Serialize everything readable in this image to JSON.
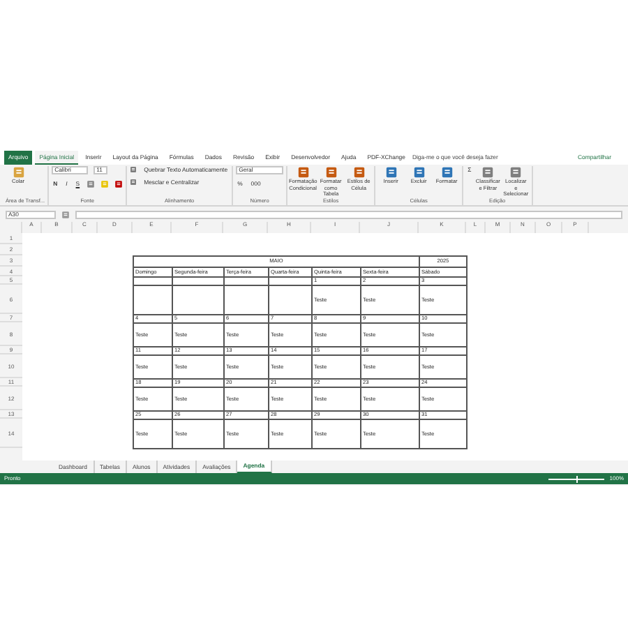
{
  "ribbon_tabs": [
    {
      "label": "Arquivo",
      "kind": "file"
    },
    {
      "label": "Página Inicial",
      "kind": "tab",
      "selected": true
    },
    {
      "label": "Inserir",
      "kind": "tab",
      "selected": false
    },
    {
      "label": "Layout da Página",
      "kind": "tab",
      "selected": false
    },
    {
      "label": "Fórmulas",
      "kind": "tab",
      "selected": false
    },
    {
      "label": "Dados",
      "kind": "tab",
      "selected": false
    },
    {
      "label": "Revisão",
      "kind": "tab",
      "selected": false
    },
    {
      "label": "Exibir",
      "kind": "tab",
      "selected": false
    },
    {
      "label": "Desenvolvedor",
      "kind": "tab",
      "selected": false
    },
    {
      "label": "Ajuda",
      "kind": "tab",
      "selected": false
    },
    {
      "label": "PDF-XChange",
      "kind": "tab",
      "selected": false
    }
  ],
  "tell_me": {
    "placeholder": "Diga-me o que você deseja fazer"
  },
  "share_button": "Compartilhar",
  "ribbon_groups": [
    {
      "name": "Área de Transf...",
      "controls": [
        {
          "kind": "big",
          "label": "Colar"
        }
      ]
    },
    {
      "name": "Fonte",
      "controls": [
        {
          "kind": "font",
          "font": "Calibri",
          "size": "11",
          "buttons": [
            "N",
            "I",
            "S"
          ]
        }
      ]
    },
    {
      "name": "Alinhamento",
      "controls": [
        {
          "kind": "wrap",
          "labels": [
            "Quebrar Texto Automaticamente",
            "Mesclar e Centralizar"
          ]
        }
      ]
    },
    {
      "name": "Número",
      "controls": [
        {
          "kind": "number",
          "format": "Geral",
          "buttons": [
            "%",
            "000"
          ]
        }
      ]
    },
    {
      "name": "Estilos",
      "controls": [
        {
          "kind": "big",
          "label": "Formatação Condicional"
        },
        {
          "kind": "big",
          "label": "Formatar como Tabela"
        },
        {
          "kind": "big",
          "label": "Estilos de Célula"
        }
      ]
    },
    {
      "name": "Células",
      "controls": [
        {
          "kind": "big",
          "label": "Inserir"
        },
        {
          "kind": "big",
          "label": "Excluir"
        },
        {
          "kind": "big",
          "label": "Formatar"
        }
      ]
    },
    {
      "name": "Edição",
      "controls": [
        {
          "kind": "sum",
          "label": "Σ"
        },
        {
          "kind": "big",
          "label": "Classificar e Filtrar"
        },
        {
          "kind": "big",
          "label": "Localizar e Selecionar"
        }
      ]
    }
  ],
  "name_box": "A30",
  "columns": [
    "A",
    "B",
    "C",
    "D",
    "E",
    "F",
    "G",
    "H",
    "I",
    "J",
    "K",
    "L",
    "M",
    "N",
    "O",
    "P"
  ],
  "row_numbers": [
    "1",
    "2",
    "3",
    "4",
    "5",
    "6",
    "7",
    "8",
    "9",
    "10",
    "11",
    "12",
    "13",
    "14"
  ],
  "calendar": {
    "month": "MAIO",
    "year": "2025",
    "weekdays": [
      "Domingo",
      "Segunda-feira",
      "Terça-feira",
      "Quarta-feira",
      "Quinta-feira",
      "Sexta-feira",
      "Sábado"
    ],
    "weeks": [
      [
        {
          "kind": "blank"
        },
        {
          "kind": "blank"
        },
        {
          "kind": "blank"
        },
        {
          "kind": "blank"
        },
        {
          "kind": "day",
          "day": "1",
          "note": "Teste"
        },
        {
          "kind": "day",
          "day": "2",
          "note": "Teste"
        },
        {
          "kind": "day",
          "day": "3",
          "note": "Teste"
        }
      ],
      [
        {
          "kind": "day",
          "day": "4",
          "note": "Teste"
        },
        {
          "kind": "day",
          "day": "5",
          "note": "Teste"
        },
        {
          "kind": "day",
          "day": "6",
          "note": "Teste"
        },
        {
          "kind": "day",
          "day": "7",
          "note": "Teste"
        },
        {
          "kind": "day",
          "day": "8",
          "note": "Teste"
        },
        {
          "kind": "day",
          "day": "9",
          "note": "Teste"
        },
        {
          "kind": "day",
          "day": "10",
          "note": "Teste"
        }
      ],
      [
        {
          "kind": "day",
          "day": "11",
          "note": "Teste"
        },
        {
          "kind": "day",
          "day": "12",
          "note": "Teste"
        },
        {
          "kind": "day",
          "day": "13",
          "note": "Teste"
        },
        {
          "kind": "day",
          "day": "14",
          "note": "Teste"
        },
        {
          "kind": "day",
          "day": "15",
          "note": "Teste"
        },
        {
          "kind": "day",
          "day": "16",
          "note": "Teste"
        },
        {
          "kind": "day",
          "day": "17",
          "note": "Teste"
        }
      ],
      [
        {
          "kind": "day",
          "day": "18",
          "note": "Teste"
        },
        {
          "kind": "day",
          "day": "19",
          "note": "Teste"
        },
        {
          "kind": "day",
          "day": "20",
          "note": "Teste"
        },
        {
          "kind": "day",
          "day": "21",
          "note": "Teste"
        },
        {
          "kind": "day",
          "day": "22",
          "note": "Teste"
        },
        {
          "kind": "day",
          "day": "23",
          "note": "Teste"
        },
        {
          "kind": "day",
          "day": "24",
          "note": "Teste"
        }
      ],
      [
        {
          "kind": "day",
          "day": "25",
          "note": "Teste"
        },
        {
          "kind": "day",
          "day": "26",
          "note": "Teste"
        },
        {
          "kind": "day",
          "day": "27",
          "note": "Teste"
        },
        {
          "kind": "day",
          "day": "28",
          "note": "Teste"
        },
        {
          "kind": "day",
          "day": "29",
          "note": "Teste"
        },
        {
          "kind": "day",
          "day": "30",
          "note": "Teste"
        },
        {
          "kind": "day",
          "day": "31",
          "note": "Teste"
        }
      ]
    ]
  },
  "sheets": [
    {
      "label": "Dashboard",
      "selected": false
    },
    {
      "label": "Tabelas",
      "selected": false
    },
    {
      "label": "Alunos",
      "selected": false
    },
    {
      "label": "Atividades",
      "selected": false
    },
    {
      "label": "Avaliações",
      "selected": false
    },
    {
      "label": "Agenda",
      "selected": true
    }
  ],
  "status": {
    "text": "Pronto",
    "zoom": "100%",
    "zoom_level": {
      "level": 0.5
    }
  }
}
